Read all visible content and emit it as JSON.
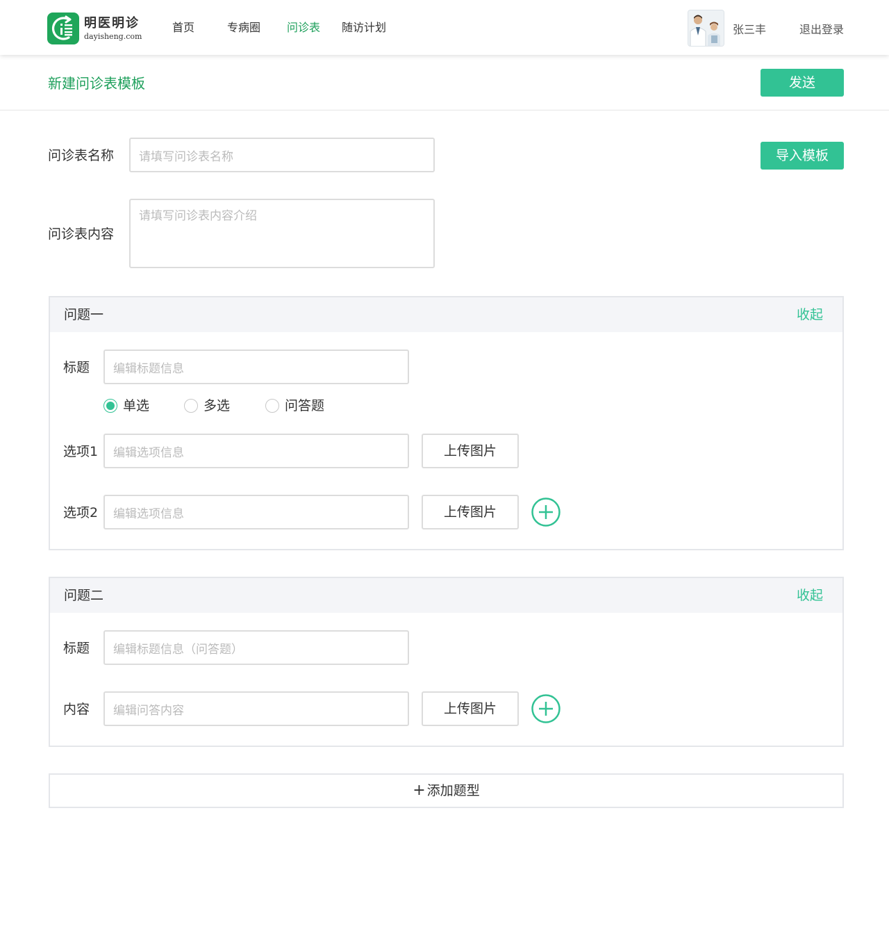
{
  "brand": {
    "name_cn": "明医明诊",
    "domain": "dayisheng.com",
    "logo_icon": "logo-mark",
    "color": "#1fa65a"
  },
  "nav": {
    "items": [
      {
        "label": "首页",
        "active": false
      },
      {
        "label": "专病圈",
        "active": false
      },
      {
        "label": "问诊表",
        "active": true
      },
      {
        "label": "随访计划",
        "active": false
      }
    ]
  },
  "user": {
    "name": "张三丰",
    "logout": "退出登录"
  },
  "page": {
    "title": "新建问诊表模板",
    "send_label": "发送",
    "import_label": "导入模板"
  },
  "form": {
    "name_label": "问诊表名称",
    "name_placeholder": "请填写问诊表名称",
    "content_label": "问诊表内容",
    "content_placeholder": "请填写问诊表内容介绍"
  },
  "questions": [
    {
      "title": "问题一",
      "collapse_label": "收起",
      "title_label": "标题",
      "title_placeholder": "编辑标题信息",
      "types": [
        {
          "label": "单选",
          "checked": true
        },
        {
          "label": "多选",
          "checked": false
        },
        {
          "label": "问答题",
          "checked": false
        }
      ],
      "options": [
        {
          "label": "选项1",
          "placeholder": "编辑选项信息",
          "upload_label": "上传图片"
        },
        {
          "label": "选项2",
          "placeholder": "编辑选项信息",
          "upload_label": "上传图片"
        }
      ]
    },
    {
      "title": "问题二",
      "collapse_label": "收起",
      "title_label": "标题",
      "title_placeholder": "编辑标题信息（问答题）",
      "content_label": "内容",
      "content_placeholder": "编辑问答内容",
      "upload_label": "上传图片"
    }
  ],
  "add_type": {
    "plus": "+",
    "label": "添加题型"
  },
  "colors": {
    "accent": "#32c294",
    "nav_active": "#1fa05c",
    "border": "#dcdcdc",
    "card_head_bg": "#f4f5f8"
  }
}
